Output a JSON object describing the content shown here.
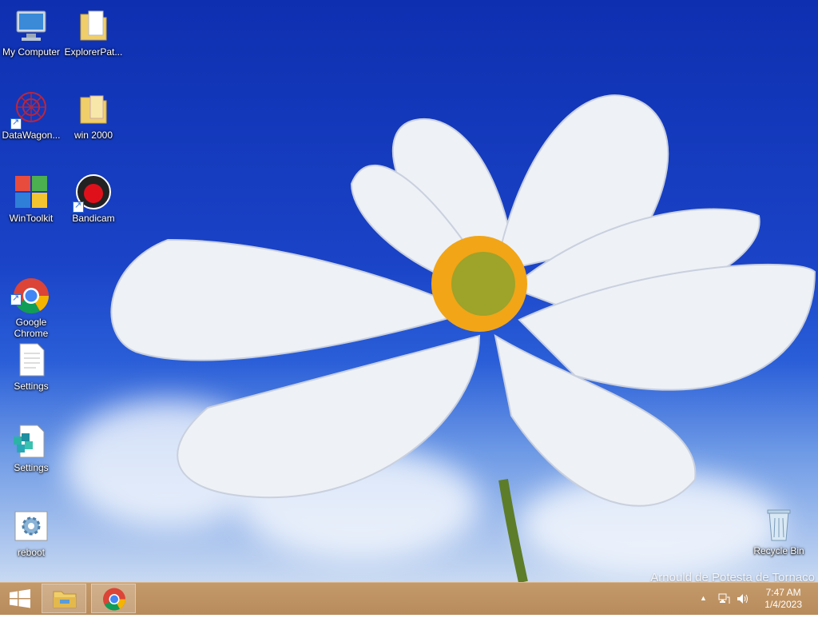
{
  "desktop": {
    "icons": [
      {
        "label": "My Computer"
      },
      {
        "label": "ExplorerPat..."
      },
      {
        "label": "DataWagon..."
      },
      {
        "label": "win 2000"
      },
      {
        "label": "WinToolkit"
      },
      {
        "label": "Bandicam"
      },
      {
        "label": "Google\nChrome"
      },
      {
        "label": "Settings"
      },
      {
        "label": "Settings"
      },
      {
        "label": "reboot"
      },
      {
        "label": "Recycle Bin"
      }
    ],
    "watermark": "Arnould de Potesta de Tornaco"
  },
  "taskbar": {
    "clock_time": "7:47 AM",
    "clock_date": "1/4/2023"
  },
  "colors": {
    "taskbar": "#b88b5b",
    "sky": "#1a43c7"
  },
  "icon_names": [
    "computer-icon",
    "folder-icon",
    "datawagon-icon",
    "folder-icon",
    "wintoolkit-icon",
    "bandicam-icon",
    "chrome-icon",
    "text-file-icon",
    "registry-icon",
    "gear-icon",
    "recycle-bin-icon"
  ]
}
